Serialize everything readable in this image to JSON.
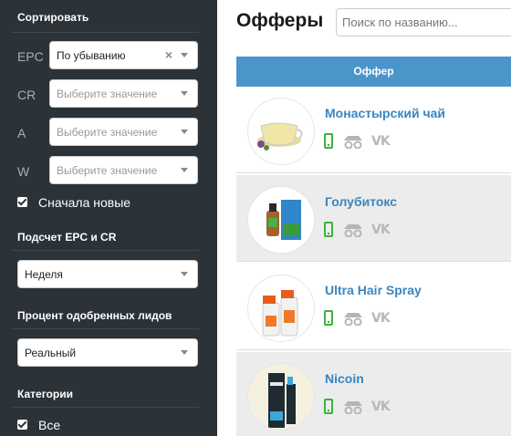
{
  "sidebar": {
    "sort": {
      "title": "Сортировать",
      "rows": [
        {
          "label": "EPC",
          "value": "По убыванию",
          "placeholder": false
        },
        {
          "label": "CR",
          "value": "Выберите значение",
          "placeholder": true
        },
        {
          "label": "A",
          "value": "Выберите значение",
          "placeholder": true
        },
        {
          "label": "W",
          "value": "Выберите значение",
          "placeholder": true
        }
      ],
      "newest_first": "Сначала новые"
    },
    "count": {
      "title": "Подсчет EPC и CR",
      "value": "Неделя"
    },
    "approved": {
      "title": "Процент одобренных лидов",
      "value": "Реальный"
    },
    "categories": {
      "title": "Категории",
      "all": "Все"
    }
  },
  "main": {
    "title": "Офферы",
    "search_placeholder": "Поиск по названию...",
    "column_header": "Оффер",
    "offers": [
      {
        "name": "Монастырский чай"
      },
      {
        "name": "Голубитокс"
      },
      {
        "name": "Ultra Hair Spray"
      },
      {
        "name": "Nicoin"
      }
    ]
  },
  "colors": {
    "sidebar_bg": "#2b3238",
    "header_blue": "#4a95c9",
    "link_blue": "#3a85bf",
    "mobile_green": "#3cb13c"
  },
  "icons": [
    "mobile-icon",
    "incognito-icon",
    "vk-icon",
    "checkbox-icon",
    "clear-icon",
    "caret-down-icon"
  ]
}
